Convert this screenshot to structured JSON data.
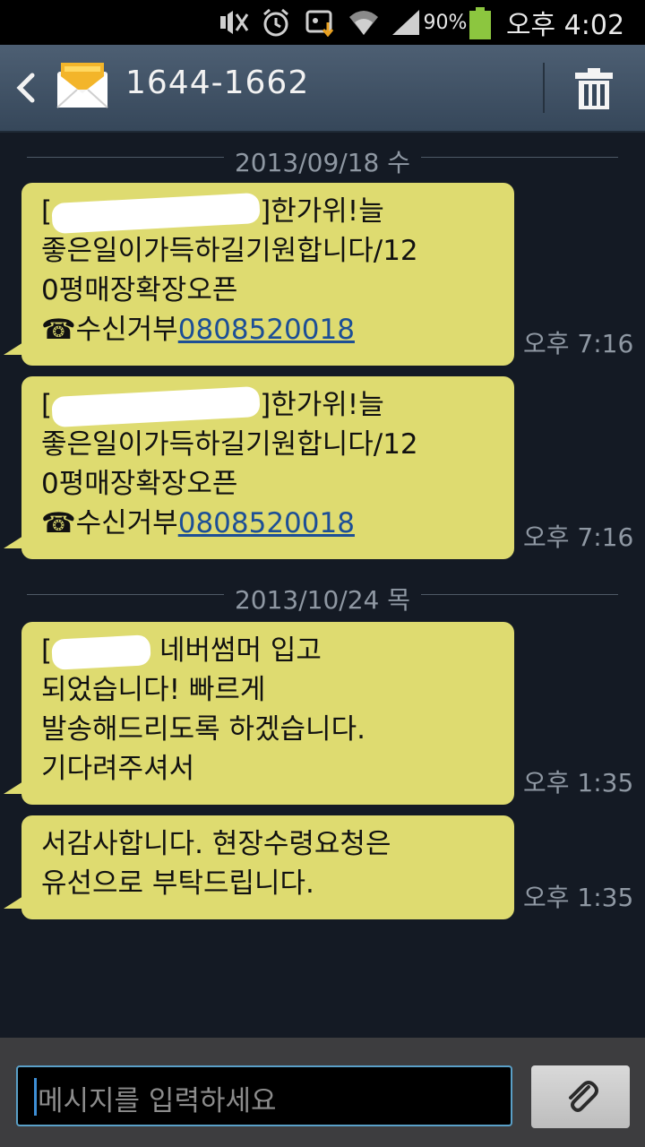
{
  "status_bar": {
    "battery_percent": "90%",
    "time": "오후 4:02",
    "icons": [
      "silent-mode-icon",
      "alarm-icon",
      "data-sync-icon",
      "wifi-icon",
      "signal-icon",
      "battery-icon"
    ]
  },
  "header": {
    "title": "1644-1662",
    "back_icon": "back-arrow-icon",
    "contact_icon": "envelope-icon",
    "delete_icon": "trash-icon"
  },
  "conversation": {
    "date_1": "2013/09/18 수",
    "date_2": "2013/10/24 목",
    "messages": [
      {
        "lines": [
          "한가위!늘",
          "좋은일이가득하길기원합니다/12",
          "0평매장확장오픈",
          "수신거부"
        ],
        "prefix": "[",
        "close": "]",
        "phone_symbol": "☎",
        "link": "0808520018",
        "time": "오후 7:16"
      },
      {
        "lines": [
          "한가위!늘",
          "좋은일이가득하길기원합니다/12",
          "0평매장확장오픈",
          "수신거부"
        ],
        "prefix": "[",
        "close": "]",
        "phone_symbol": "☎",
        "link": "0808520018",
        "time": "오후 7:16"
      },
      {
        "lines": [
          "네버썸머 입고",
          "되었습니다! 빠르게",
          "발송해드리도록 하겠습니다.",
          "기다려주셔서"
        ],
        "prefix": "[",
        "time": "오후 1:35"
      },
      {
        "lines": [
          "서감사합니다. 현장수령요청은",
          "유선으로 부탁드립니다."
        ],
        "time": "오후 1:35"
      }
    ]
  },
  "composer": {
    "placeholder": "메시지를 입력하세요",
    "attach_icon": "paperclip-icon"
  },
  "colors": {
    "bubble": "#dedb70",
    "background": "#141a24",
    "header": "#3f5063",
    "link": "#1d4f96",
    "battery": "#8cc63f"
  }
}
